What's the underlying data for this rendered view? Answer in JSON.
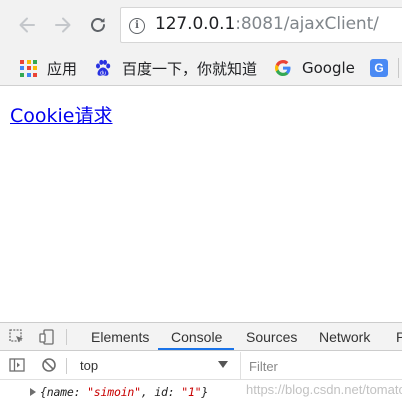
{
  "browser": {
    "nav": {
      "back_icon": "arrow-left-icon",
      "forward_icon": "arrow-right-icon",
      "reload_icon": "reload-icon"
    },
    "url": {
      "info_icon": "info-icon",
      "host": "127.0.0.1",
      "rest": ":8081/ajaxClient/"
    },
    "bookmarks": [
      {
        "label": "应用",
        "icon": "apps-grid-icon"
      },
      {
        "label": "百度一下，你就知道",
        "icon": "baidu-paw-icon"
      },
      {
        "label": "Google",
        "icon": "google-g-icon"
      },
      {
        "label": "",
        "icon": "google-translate-icon"
      }
    ]
  },
  "page": {
    "link_text": "Cookie请求"
  },
  "devtools": {
    "tabs": [
      "Elements",
      "Console",
      "Sources",
      "Network",
      "P"
    ],
    "active_tab": "Console",
    "context_value": "top",
    "filter_placeholder": "Filter",
    "console": {
      "open": "{name: ",
      "name_value": "\"simoin\"",
      "mid": ", id: ",
      "id_value": "\"1\"",
      "close": "}"
    },
    "watermark": "https://blog.csdn.net/tomatocc"
  },
  "colors": {
    "link": "#0000ee",
    "active_tab_underline": "#1a73e8",
    "string_value": "#c80000"
  }
}
